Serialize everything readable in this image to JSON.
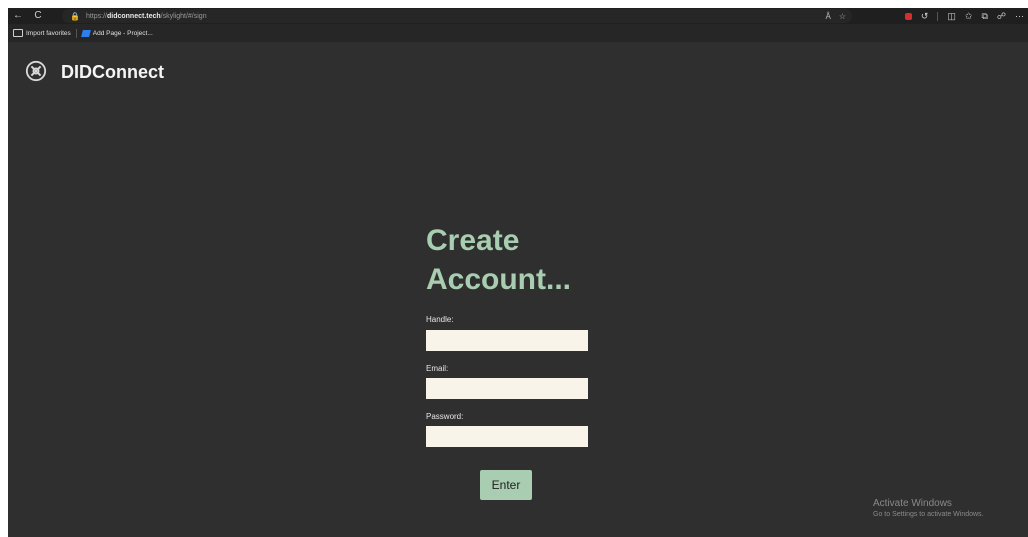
{
  "browser": {
    "back_icon": "←",
    "refresh_icon": "C",
    "url_scheme": "https://",
    "url_host": "didconnect.tech",
    "url_path": "/skylight/#/sign",
    "bookmarks": [
      {
        "label": "Import favorites"
      },
      {
        "label": "Add Page - Project..."
      }
    ]
  },
  "header": {
    "brand": "DIDConnect"
  },
  "form": {
    "title_line1": "Create",
    "title_line2": "Account...",
    "handle_label": "Handle:",
    "handle_value": "",
    "email_label": "Email:",
    "email_value": "",
    "password_label": "Password:",
    "password_value": "",
    "submit_label": "Enter"
  },
  "watermark": {
    "title": "Activate Windows",
    "subtitle": "Go to Settings to activate Windows."
  },
  "colors": {
    "background": "#2f2f2f",
    "accent": "#a8cdb0",
    "input_bg": "#f8f4ea"
  }
}
